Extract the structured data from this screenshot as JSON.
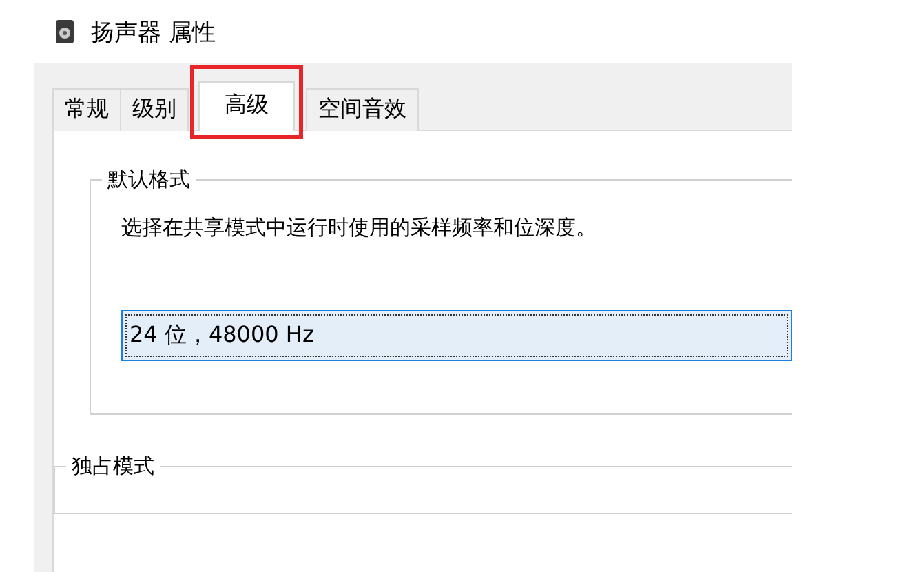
{
  "window": {
    "title": "扬声器 属性"
  },
  "tabs": [
    {
      "label": "常规",
      "selected": false,
      "highlighted": false
    },
    {
      "label": "级别",
      "selected": false,
      "highlighted": false
    },
    {
      "label": "高级",
      "selected": true,
      "highlighted": true
    },
    {
      "label": "空间音效",
      "selected": false,
      "highlighted": false
    }
  ],
  "default_format": {
    "title": "默认格式",
    "description": "选择在共享模式中运行时使用的采样频率和位深度。",
    "format_value": "24 位，48000 Hz"
  },
  "exclusive_mode": {
    "title": "独占模式"
  }
}
